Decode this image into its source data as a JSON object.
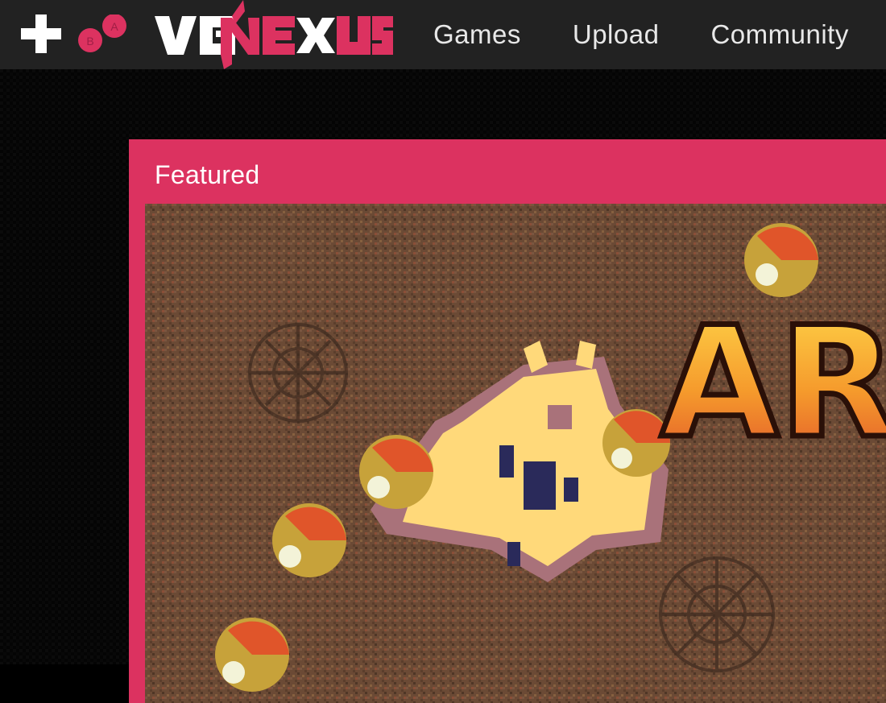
{
  "brand": {
    "name": "VGNEXUS",
    "controller_buttons": [
      "B",
      "A"
    ],
    "colors": {
      "accent": "#dc3260",
      "topbar": "#222222",
      "text": "#ffffff"
    }
  },
  "nav": {
    "items": [
      {
        "label": "Games"
      },
      {
        "label": "Upload"
      },
      {
        "label": "Community"
      }
    ]
  },
  "featured": {
    "heading": "Featured",
    "game_title_fragment": "AR"
  }
}
